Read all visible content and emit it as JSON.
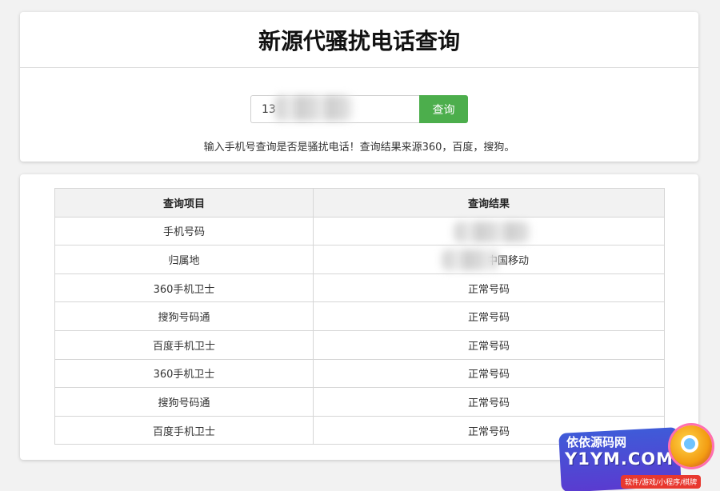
{
  "header": {
    "title": "新源代骚扰电话查询"
  },
  "search": {
    "phone_value": "13",
    "button_label": "查询",
    "hint": "输入手机号查询是否是骚扰电话！查询结果来源360，百度，搜狗。"
  },
  "results": {
    "columns": [
      "查询项目",
      "查询结果"
    ],
    "rows": [
      {
        "item": "手机号码",
        "result": ""
      },
      {
        "item": "归属地",
        "result": "中国移动"
      },
      {
        "item": "360手机卫士",
        "result": "正常号码"
      },
      {
        "item": "搜狗号码通",
        "result": "正常号码"
      },
      {
        "item": "百度手机卫士",
        "result": "正常号码"
      },
      {
        "item": "360手机卫士",
        "result": "正常号码"
      },
      {
        "item": "搜狗号码通",
        "result": "正常号码"
      },
      {
        "item": "百度手机卫士",
        "result": "正常号码"
      }
    ]
  },
  "watermark": {
    "line1": "依依源码网",
    "line2": "Y1YM.COM",
    "tag": "软件/游戏/小程序/棋牌"
  },
  "colors": {
    "accent_button": "#4cae4c",
    "header_row_bg": "#f2f2f2",
    "page_bg": "#f2f2f2"
  }
}
